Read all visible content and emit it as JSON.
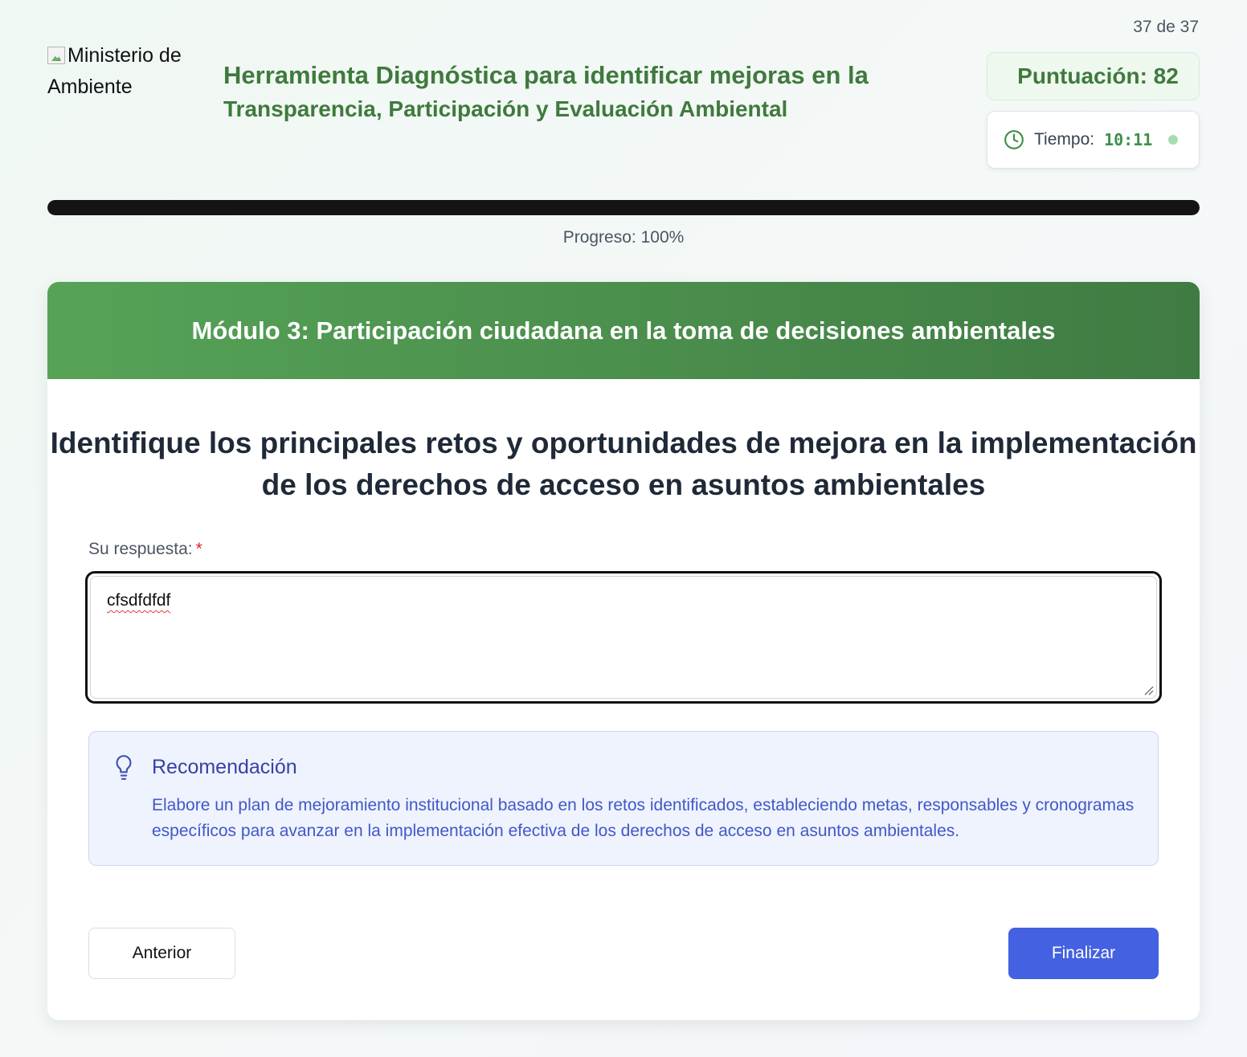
{
  "header": {
    "logo_alt": "Ministerio de Ambiente",
    "title_line1": "Herramienta Diagnóstica para identificar mejoras en la",
    "title_line2": "Transparencia, Participación y Evaluación Ambiental",
    "counter": "37 de 37",
    "score": "Puntuación: 82",
    "timer_label": "Tiempo:",
    "timer_value": "10:11"
  },
  "progress": {
    "percent": 100,
    "label": "Progreso: 100%"
  },
  "module": {
    "title": "Módulo 3: Participación ciudadana en la toma de decisiones ambientales"
  },
  "question": {
    "text": "Identifique los principales retos y oportunidades de mejora en la implementación de los derechos de acceso en asuntos ambientales",
    "answer_label": "Su respuesta:",
    "required_mark": "*",
    "answer_value": "cfsdfdfdf"
  },
  "recommendation": {
    "title": "Recomendación",
    "text": "Elabore un plan de mejoramiento institucional basado en los retos identificados, estableciendo metas, responsables y cronogramas específicos para avanzar en la implementación efectiva de los derechos de acceso en asuntos ambientales."
  },
  "buttons": {
    "previous": "Anterior",
    "finish": "Finalizar"
  },
  "colors": {
    "brand_green": "#3f7a3d",
    "module_header_start": "#56a357",
    "module_header_end": "#3f7b43",
    "finish_button": "#4361e0",
    "recommend_text": "#4357c9"
  },
  "icons": {
    "timer": "clock-icon",
    "recommendation": "lightbulb-icon"
  }
}
